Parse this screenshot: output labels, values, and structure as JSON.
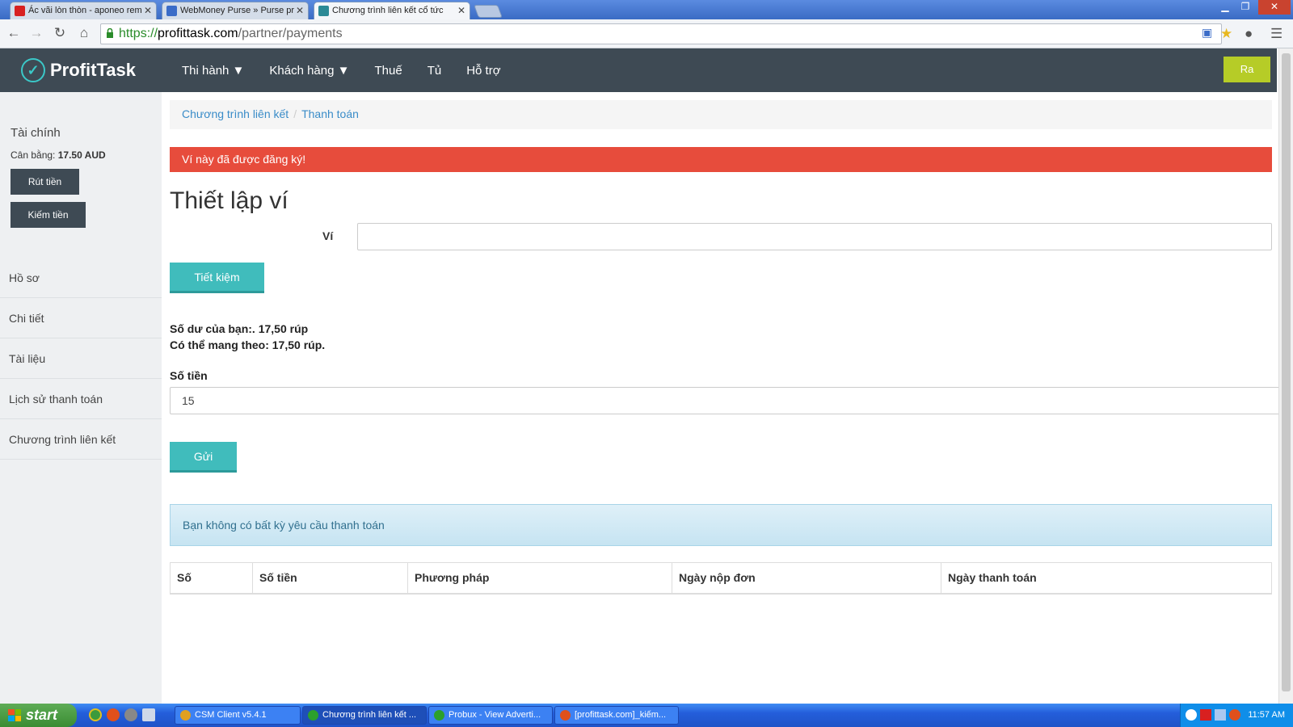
{
  "browser": {
    "tabs": [
      {
        "title": "Ác vãi lòn thòn - aponeo rem",
        "favicon_color": "#d82020"
      },
      {
        "title": "WebMoney Purse » Purse pr",
        "favicon_color": "#3a6cc8"
      },
      {
        "title": "Chương trình liên kết cổ tức",
        "favicon_color": "#2c8a96"
      }
    ],
    "url_scheme": "https://",
    "url_host": "profittask.com",
    "url_path": "/partner/payments"
  },
  "header": {
    "logo_text": "ProfitTask",
    "nav": [
      "Thi hành ▼",
      "Khách hàng ▼",
      "Thuế",
      "Tủ",
      "Hỗ trợ"
    ],
    "logout_label": "Ra"
  },
  "sidebar": {
    "finance_title": "Tài chính",
    "balance_label": "Cân bằng:",
    "balance_value": "17.50 AUD",
    "withdraw_label": "Rút tiền",
    "earn_label": "Kiếm tiền",
    "menu": [
      "Hồ sơ",
      "Chi tiết",
      "Tài liệu",
      "Lịch sử thanh toán",
      "Chương trình liên kết"
    ]
  },
  "main": {
    "breadcrumb": [
      "Chương trình liên kết",
      "Thanh toán"
    ],
    "error_alert": "Ví này đã được đăng ký!",
    "title": "Thiết lập ví",
    "wallet_label": "Ví",
    "wallet_value": "",
    "save_label": "Tiết kiệm",
    "balance_line": "Số dư của bạn:. 17,50 rúp",
    "available_line": "Có thể mang theo: 17,50 rúp.",
    "amount_label": "Số tiền",
    "amount_value": "15",
    "send_label": "Gửi",
    "info_alert": "Bạn không có bất kỳ yêu cầu thanh toán",
    "table_headers": [
      "Số",
      "Số tiền",
      "Phương pháp",
      "Ngày nộp đơn",
      "Ngày thanh toán"
    ]
  },
  "taskbar": {
    "start_label": "start",
    "tasks": [
      {
        "label": "CSM Client v5.4.1",
        "icon_color": "#e0a020"
      },
      {
        "label": "Chương trình liên kết ...",
        "icon_color": "#2ca02c"
      },
      {
        "label": "Probux - View Adverti...",
        "icon_color": "#2ca02c"
      },
      {
        "label": "[profittask.com]_kiếm...",
        "icon_color": "#e0501c"
      }
    ],
    "clock": "11:57 AM"
  },
  "colors": {
    "header_bg": "#3e4a54",
    "accent_teal": "#40bcbc",
    "logout_green": "#b6cc27",
    "error_red": "#e74c3c",
    "info_blue": "#d5edf7",
    "link_blue": "#3a8cc8"
  }
}
